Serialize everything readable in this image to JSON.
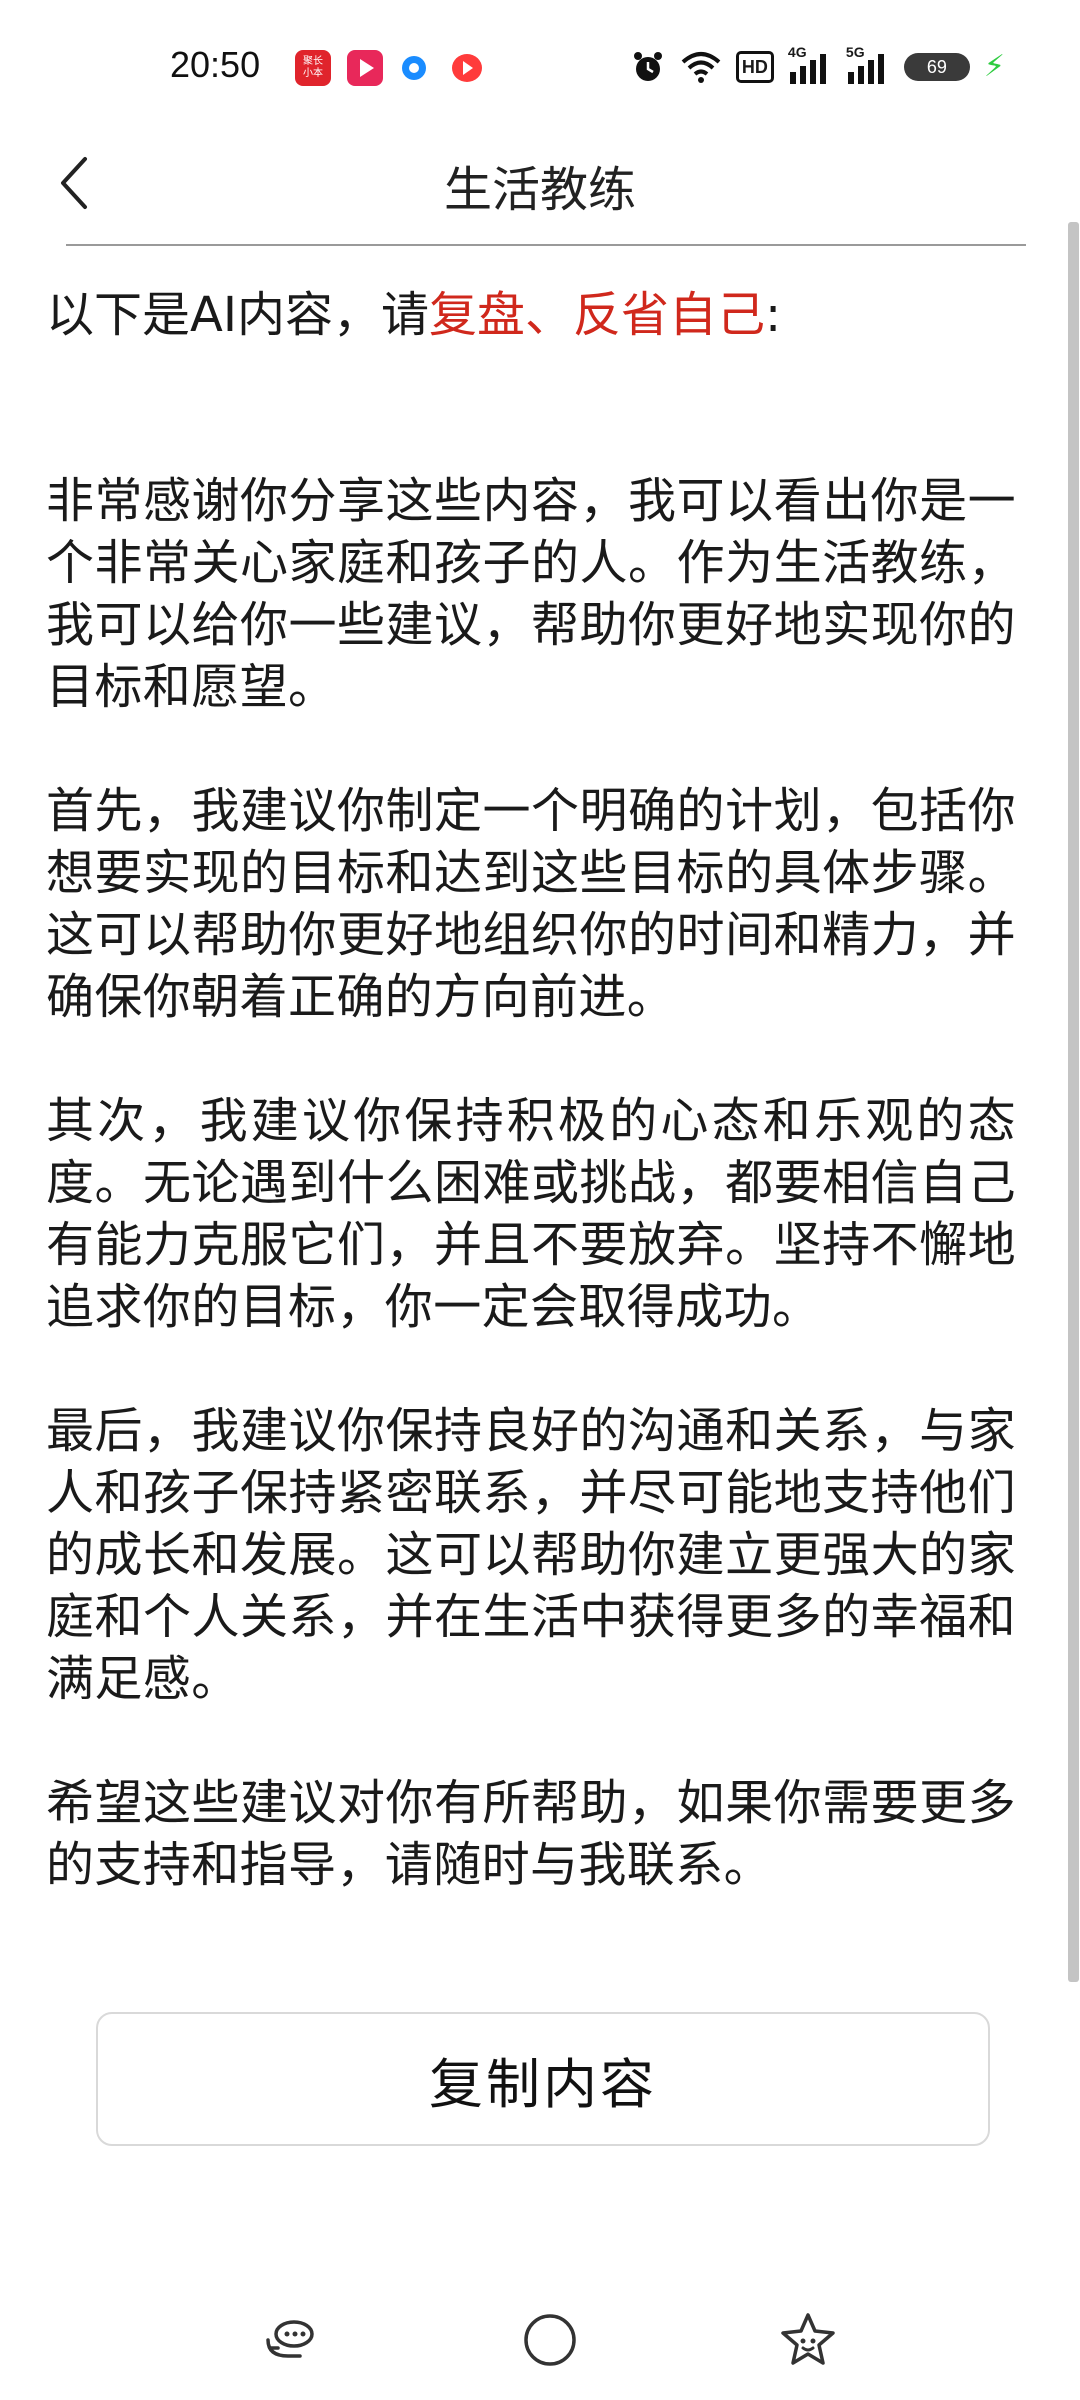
{
  "status_bar": {
    "time": "20:50",
    "notification_icons": [
      "app-badge-icon",
      "video-play-icon",
      "blue-dot-app-icon",
      "red-play-app-icon"
    ],
    "notif_badge_text": "聚长\n小本",
    "system_icons": [
      "alarm-icon",
      "wifi-icon",
      "hd-icon",
      "signal-4g-icon",
      "signal-5g-icon",
      "battery-icon",
      "charging-icon"
    ],
    "hd_label": "HD",
    "net_4g": "4G",
    "net_5g": "5G",
    "battery_level": "69",
    "colors": {
      "charging": "#2ecc40"
    }
  },
  "header": {
    "title": "生活教练",
    "back_icon": "chevron-left-icon"
  },
  "content": {
    "intro_prefix": "以下是AI内容，请",
    "intro_accent": "复盘、反省自己",
    "intro_suffix": ":",
    "accent_color": "#d0281c",
    "paragraphs": [
      "非常感谢你分享这些内容，我可以看出你是一个非常关心家庭和孩子的人。作为生活教练，我可以给你一些建议，帮助你更好地实现你的目标和愿望。",
      "首先，我建议你制定一个明确的计划，包括你想要实现的目标和达到这些目标的具体步骤。这可以帮助你更好地组织你的时间和精力，并确保你朝着正确的方向前进。",
      "其次，我建议你保持积极的心态和乐观的态度。无论遇到什么困难或挑战，都要相信自己有能力克服它们，并且不要放弃。坚持不懈地追求你的目标，你一定会取得成功。",
      "最后，我建议你保持良好的沟通和关系，与家人和孩子保持紧密联系，并尽可能地支持他们的成长和发展。这可以帮助你建立更强大的家庭和个人关系，并在生活中获得更多的幸福和满足感。",
      "希望这些建议对你有所帮助，如果你需要更多的支持和指导，请随时与我联系。"
    ]
  },
  "actions": {
    "copy_label": "复制内容"
  },
  "bottom_nav": {
    "items": [
      "chat-bubble-icon",
      "moon-compass-icon",
      "star-face-icon"
    ]
  }
}
